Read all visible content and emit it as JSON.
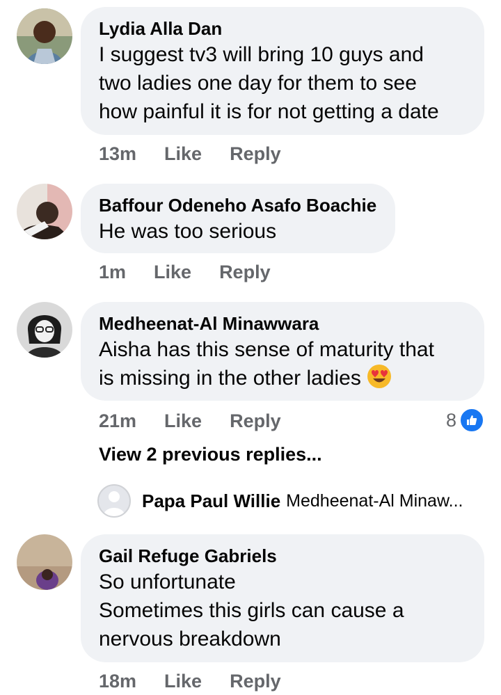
{
  "comments": [
    {
      "author": "Lydia Alla Dan",
      "lines": [
        "I suggest tv3 will bring 10 guys and",
        "two ladies one day for them to see",
        "how painful it is for not getting a date"
      ],
      "time": "13m",
      "like_label": "Like",
      "reply_label": "Reply"
    },
    {
      "author": "Baffour Odeneho Asafo Boachie",
      "lines": [
        "He was too serious"
      ],
      "time": "1m",
      "like_label": "Like",
      "reply_label": "Reply"
    },
    {
      "author": "Medheenat-Al Minawwara",
      "lines": [
        "Aisha has this sense of maturity that",
        "is missing in the other ladies"
      ],
      "emoji": "heart-eyes-emoji",
      "time": "21m",
      "like_label": "Like",
      "reply_label": "Reply",
      "reaction_count": "8"
    },
    {
      "author": "Gail Refuge Gabriels",
      "lines": [
        "So unfortunate",
        "Sometimes this girls can cause a",
        "nervous breakdown"
      ],
      "time": "18m",
      "like_label": "Like",
      "reply_label": "Reply"
    }
  ],
  "replies": {
    "view_label": "View 2 previous replies...",
    "latest_author": "Papa Paul Willie",
    "latest_preview": "Medheenat-Al Minaw..."
  },
  "colors": {
    "bubble": "#f0f2f5",
    "meta_text": "#65676b",
    "like_blue": "#1877f2"
  }
}
